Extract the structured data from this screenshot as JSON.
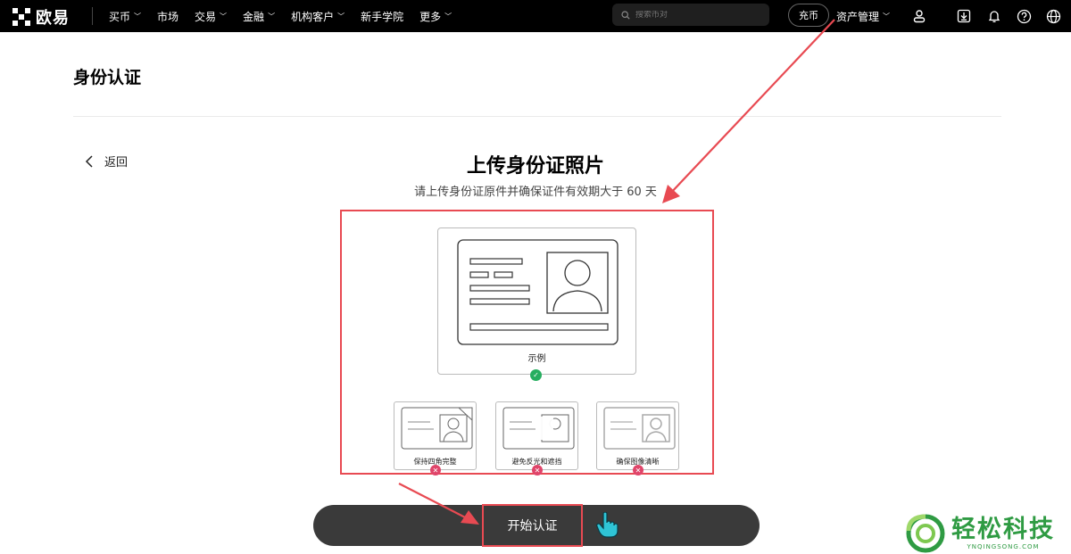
{
  "brand": {
    "name": "欧易"
  },
  "nav": [
    {
      "label": "买币",
      "dropdown": true
    },
    {
      "label": "市场",
      "dropdown": false
    },
    {
      "label": "交易",
      "dropdown": true
    },
    {
      "label": "金融",
      "dropdown": true
    },
    {
      "label": "机构客户",
      "dropdown": true
    },
    {
      "label": "新手学院",
      "dropdown": false
    },
    {
      "label": "更多",
      "dropdown": true
    }
  ],
  "search": {
    "placeholder": "搜索币对"
  },
  "header": {
    "deposit_label": "充币",
    "asset_label": "资产管理"
  },
  "icons": [
    "user-icon",
    "download-icon",
    "bell-icon",
    "help-icon",
    "globe-icon"
  ],
  "page": {
    "title": "身份认证",
    "back_label": "返回"
  },
  "upload": {
    "heading": "上传身份证照片",
    "subheading": "请上传身份证原件并确保证件有效期大于 60 天",
    "example_label": "示例",
    "tips": [
      {
        "label": "保持四角完整"
      },
      {
        "label": "避免反光和遮挡"
      },
      {
        "label": "确保图像清晰"
      }
    ]
  },
  "actions": {
    "start_label": "开始认证"
  },
  "watermark": {
    "cn": "轻松科技",
    "en": "YNQINGSONG.COM"
  },
  "colors": {
    "highlight": "#e84a52",
    "success": "#27ae60",
    "error": "#e0456a",
    "button": "#3a3a3a",
    "watermark": "#2f9b43"
  }
}
